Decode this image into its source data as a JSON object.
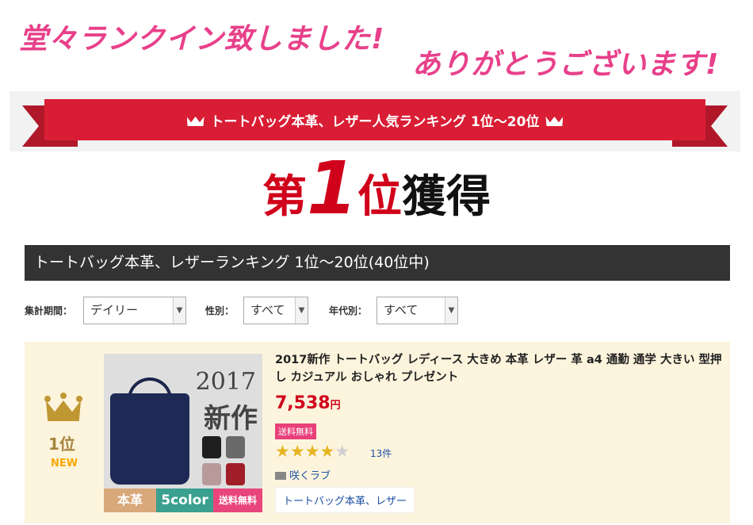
{
  "headline": {
    "line1": "堂々ランクイン致しました!",
    "line2": "ありがとうございます!"
  },
  "ribbon": {
    "text": "トートバッグ本革、レザー人気ランキング 1位〜20位"
  },
  "rank_banner": {
    "prefix": "第",
    "number": "1",
    "suffix": "位",
    "tail": "獲得"
  },
  "ranking_bar": {
    "title": "トートバッグ本革、レザーランキング 1位〜20位(40位中)"
  },
  "filters": {
    "period_label": "集計期間：",
    "period_value": "デイリー",
    "gender_label": "性別：",
    "gender_value": "すべて",
    "age_label": "年代別：",
    "age_value": "すべて"
  },
  "item": {
    "rank": "1位",
    "badge": "NEW",
    "image_text": {
      "year": "2017",
      "shinsaku": "新作",
      "honkawa": "本革",
      "colors": "5color",
      "free_ship": "送料無料"
    },
    "title": "2017新作 トートバッグ レディース 大きめ 本革 レザー 革 a4 通勤 通学 大きい 型押し カジュアル おしゃれ プレゼント",
    "price": "7,538",
    "price_unit": "円",
    "shipping": "送料無料",
    "rating": 4,
    "review_count": "13件",
    "shop": "咲くラブ",
    "category": "トートバッグ本革、レザー"
  },
  "colors": {
    "pink": "#e8408a",
    "red": "#d91d34",
    "dark": "#333333",
    "card_bg": "#fdf4dd",
    "gold": "#bf9733",
    "link": "#1a4fa3"
  },
  "icons": [
    "crown-icon",
    "crown-icon",
    "crown-icon",
    "chevron-down-icon",
    "shop-icon",
    "star-icon"
  ]
}
